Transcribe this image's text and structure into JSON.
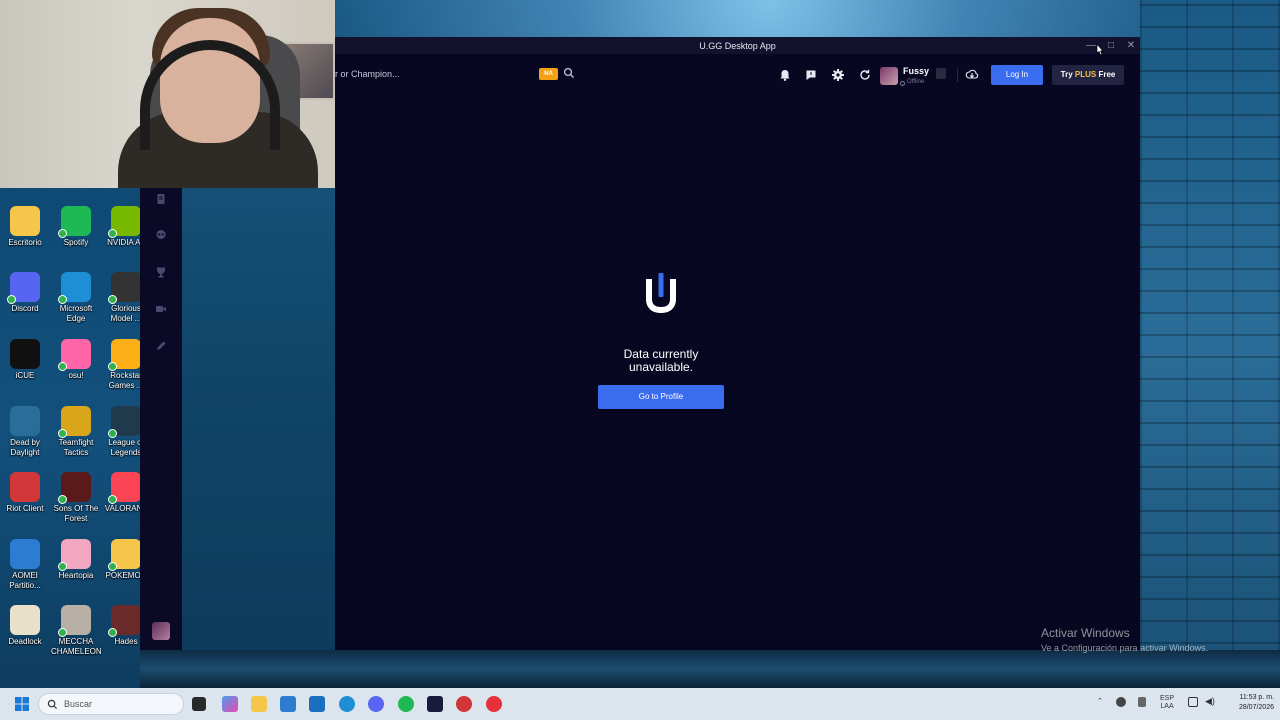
{
  "window": {
    "title": "U.GG Desktop App",
    "controls": [
      "minimize",
      "maximize",
      "close"
    ]
  },
  "topbar": {
    "search_placeholder": "r or Champion...",
    "region": "NA",
    "user": {
      "name": "Fussy",
      "status": "Offline"
    },
    "login_label": "Log In",
    "plus_label_prefix": "Try ",
    "plus_label_gold": "PLUS",
    "plus_label_suffix": " Free"
  },
  "main": {
    "message_line1": "Data currently",
    "message_line2": "unavailable.",
    "profile_button": "Go to Profile"
  },
  "desktop_icons": [
    {
      "label": "Escritorio",
      "color": "#f5c64a"
    },
    {
      "label": "Spotify",
      "color": "#1db954"
    },
    {
      "label": "NVIDIA Ap",
      "color": "#76b900"
    },
    {
      "label": "Discord",
      "color": "#5865f2"
    },
    {
      "label": "Microsoft Edge",
      "color": "#1e8fd6"
    },
    {
      "label": "Glorious Model ...",
      "color": "#333333"
    },
    {
      "label": "iCUE",
      "color": "#111111"
    },
    {
      "label": "osu!",
      "color": "#ff66aa"
    },
    {
      "label": "Rockstar Games ...",
      "color": "#fcaf17"
    },
    {
      "label": "Dead by Daylight",
      "color": "#2a6d98"
    },
    {
      "label": "Teamfight Tactics",
      "color": "#d9a51a"
    },
    {
      "label": "League of Legends",
      "color": "#1e3a4c"
    },
    {
      "label": "Riot Client",
      "color": "#d13639"
    },
    {
      "label": "Sons Of The Forest",
      "color": "#5a1a1a"
    },
    {
      "label": "VALORANT",
      "color": "#fa4454"
    },
    {
      "label": "AOMEI Partitio...",
      "color": "#2c7cd1"
    },
    {
      "label": "Heartopia",
      "color": "#f1a7c0"
    },
    {
      "label": "POKEMON",
      "color": "#f5c64a"
    },
    {
      "label": "Deadlock",
      "color": "#e8e0c8"
    },
    {
      "label": "MECCHA CHAMELEON",
      "color": "#b8b0a6"
    },
    {
      "label": "Hades",
      "color": "#6a2a2a"
    }
  ],
  "watermark": {
    "line1": "Activar Windows",
    "line2": "Ve a Configuración para activar Windows."
  },
  "taskbar": {
    "search_placeholder": "Buscar",
    "lang": "ESP\nLAA",
    "time": "11:53 p. m.",
    "date": "28/07/2026"
  }
}
